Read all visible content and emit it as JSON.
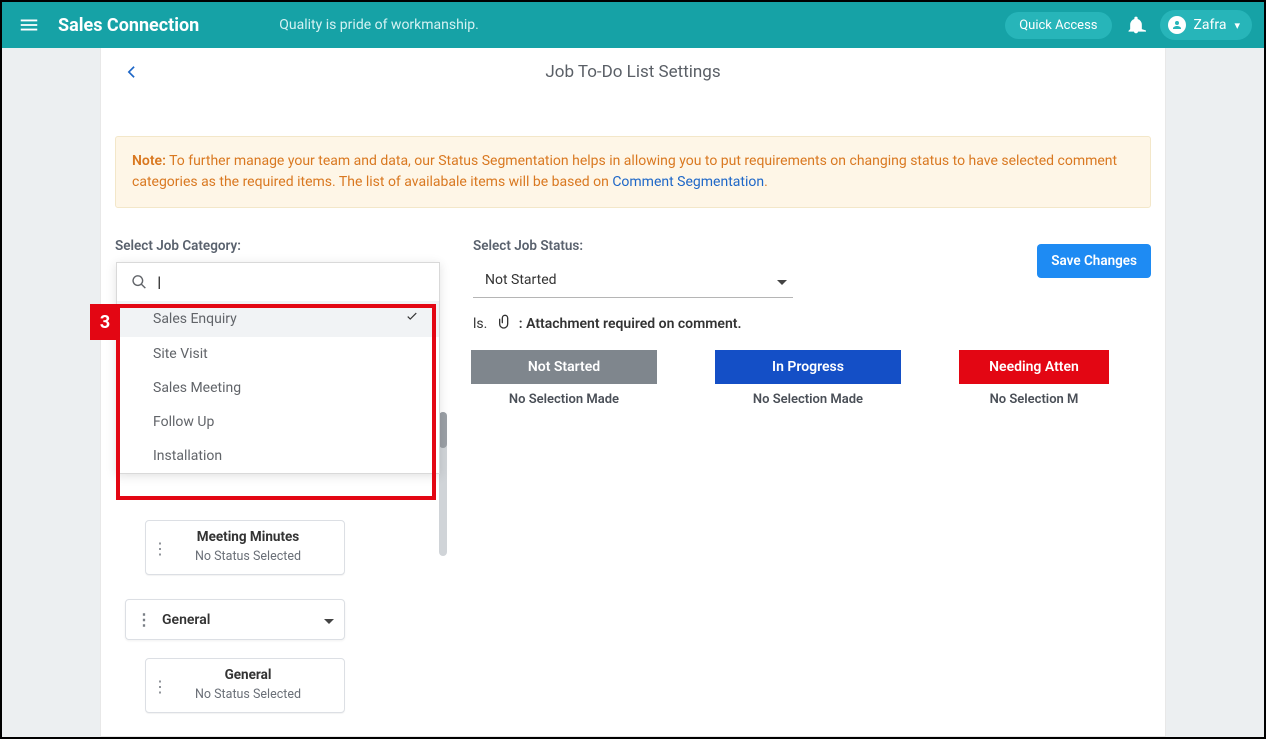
{
  "app": {
    "title": "Sales Connection",
    "tagline": "Quality is pride of workmanship."
  },
  "header": {
    "quick_access": "Quick Access",
    "user_name": "Zafra"
  },
  "page": {
    "title": "Job To-Do List Settings"
  },
  "note": {
    "prefix": "Note:",
    "text_a": " To further manage your team and data, our Status Segmentation helps in allowing you to put requirements on changing status to have selected comment categories as the required items. The list of availabale items will be based on ",
    "link": "Comment Segmentation",
    "text_b": "."
  },
  "controls": {
    "category_label": "Select Job Category:",
    "status_label": "Select Job Status:",
    "status_value": "Not Started",
    "save_label": "Save Changes"
  },
  "legend": {
    "text": ": Attachment required on comment."
  },
  "category_dropdown": {
    "search_placeholder": "",
    "options": [
      {
        "label": "Sales Enquiry",
        "selected": true
      },
      {
        "label": "Site Visit",
        "selected": false
      },
      {
        "label": "Sales Meeting",
        "selected": false
      },
      {
        "label": "Follow Up",
        "selected": false
      },
      {
        "label": "Installation",
        "selected": false
      }
    ]
  },
  "annotation": {
    "tag": "3"
  },
  "status_columns": [
    {
      "label": "Not Started",
      "empty_text": "No Selection Made",
      "color": "gray"
    },
    {
      "label": "In Progress",
      "empty_text": "No Selection Made",
      "color": "blue"
    },
    {
      "label": "Needing Atten",
      "empty_text": "No Selection M",
      "color": "red"
    }
  ],
  "left_panel": {
    "item1": {
      "title": "Meeting Minutes",
      "sub": "No Status Selected"
    },
    "group": {
      "title": "General"
    },
    "item2": {
      "title": "General",
      "sub": "No Status Selected"
    }
  }
}
